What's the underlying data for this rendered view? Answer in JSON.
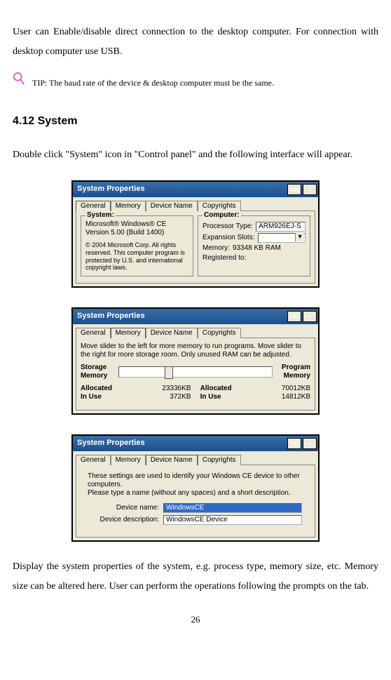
{
  "intro_para": "User can Enable/disable direct connection to the desktop computer. For connection with desktop computer use USB.",
  "tip_text": "TIP: The baud rate of the device & desktop computer must be the same.",
  "section_heading": "4.12 System",
  "section_intro": "Double click \"System\" icon in \"Control panel\" and the following interface will appear.",
  "closing_para": "Display the system properties of the system, e.g. process type, memory size, etc. Memory size can be altered here. User can perform the operations following the prompts on the tab.",
  "page_number": "26",
  "dlg_title": "System Properties",
  "btn_ok": "OK",
  "btn_close": "×",
  "tabs": {
    "general": "General",
    "memory": "Memory",
    "devicename": "Device Name",
    "copyrights": "Copyrights"
  },
  "d1": {
    "system_legend": "System:",
    "computer_legend": "Computer:",
    "os_line1": "Microsoft® Windows® CE",
    "os_line2": "Version 5.00 (Build 1400)",
    "copyright": "© 2004 Microsoft Corp. All rights reserved. This computer program is protected by U.S. and international copyright laws.",
    "proc_label": "Processor Type:",
    "proc_value": "ARM926EJ-S",
    "exp_label": "Expansion Slots:",
    "mem_label": "Memory:",
    "mem_value": "93348 KB  RAM",
    "reg_label": "Registered to:"
  },
  "d2": {
    "instr": "Move slider to the left for more memory to run programs. Move slider to the right for more storage room. Only unused RAM can be adjusted.",
    "left_title": "Storage\nMemory",
    "right_title": "Program\nMemory",
    "alloc_label": "Allocated",
    "inuse_label": "In Use",
    "left_alloc": "23336KB",
    "left_inuse": "372KB",
    "right_alloc": "70012KB",
    "right_inuse": "14812KB"
  },
  "d3": {
    "instr": "These settings are used to identify your Windows CE device to other computers.\nPlease type a name (without any spaces) and a short description.",
    "name_label": "Device name:",
    "name_value": "WindowsCE",
    "desc_label": "Device description:",
    "desc_value": "WindowsCE Device"
  }
}
